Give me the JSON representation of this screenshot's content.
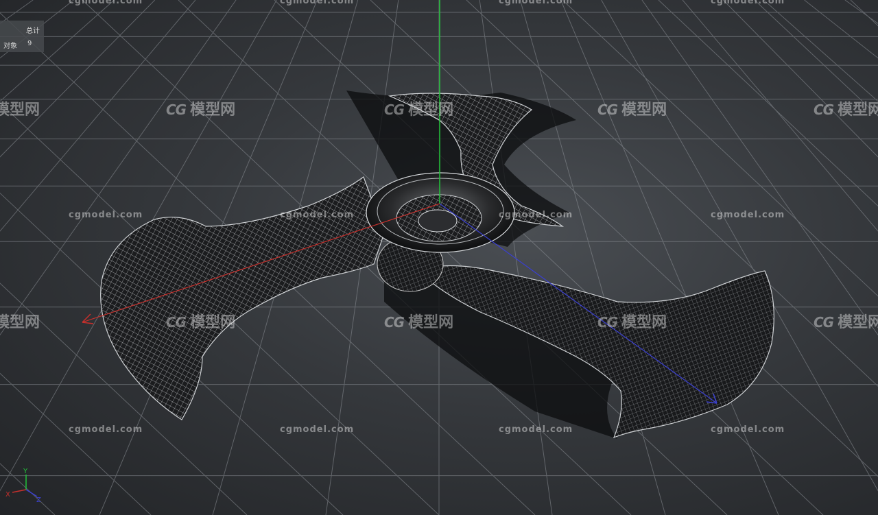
{
  "stats": {
    "header": "总计",
    "objects_label": "对象",
    "objects_value": "9"
  },
  "watermark": {
    "url": "cgmodel.com",
    "logo_mark": "CG",
    "logo_text": "模型网"
  },
  "gizmo": {
    "x": "X",
    "y": "Y",
    "z": "Z"
  },
  "colors": {
    "x_axis": "#c8302c",
    "y_axis": "#22c43a",
    "z_axis": "#3a3fd0",
    "grid": "#8c9096"
  }
}
